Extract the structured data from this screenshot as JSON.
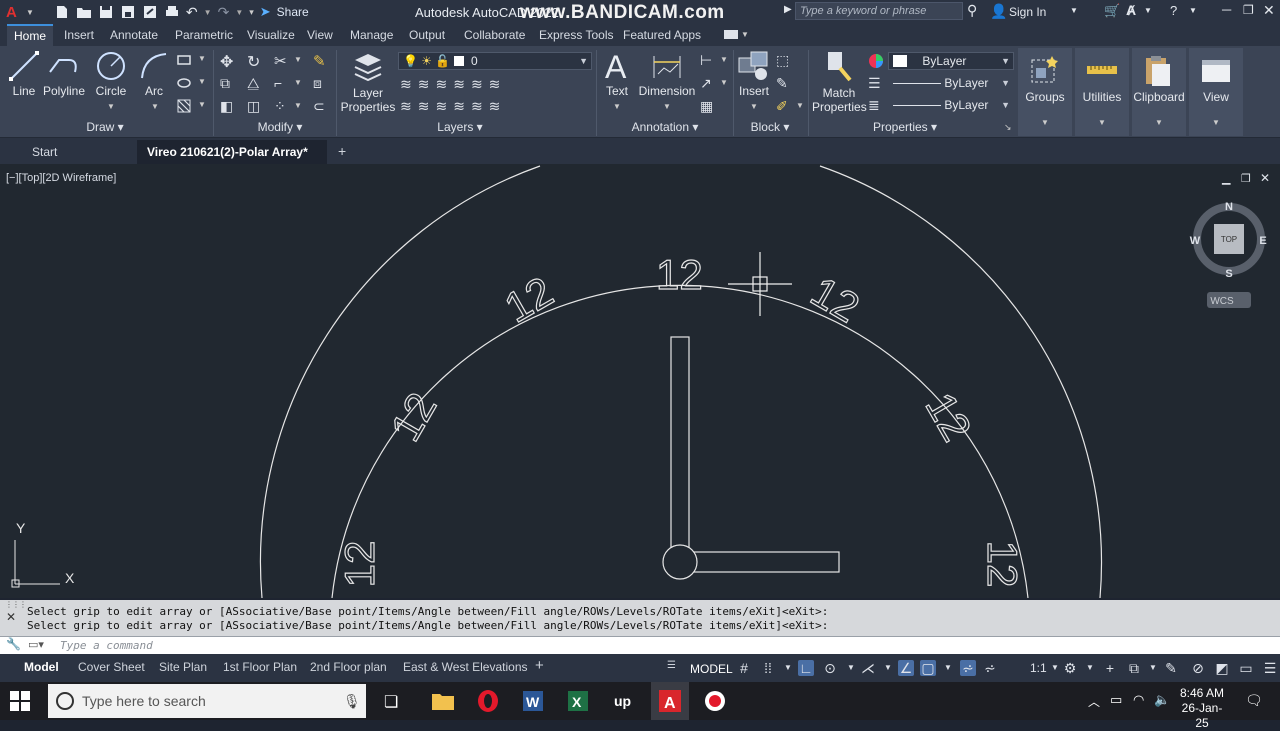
{
  "window": {
    "app_title": "Autodesk AutoCAD 2022",
    "doc_title_partial": "Vireo 210621(2)",
    "watermark": "www.BANDICAM.com",
    "share_label": "Share",
    "search_placeholder": "Type a keyword or phrase",
    "signin_label": "Sign In"
  },
  "ribbon_tabs": [
    "Home",
    "Insert",
    "Annotate",
    "Parametric",
    "Visualize",
    "View",
    "Manage",
    "Output",
    "Collaborate",
    "Express Tools",
    "Featured Apps"
  ],
  "active_tab": "Home",
  "draw": {
    "label": "Draw",
    "line": "Line",
    "polyline": "Polyline",
    "circle": "Circle",
    "arc": "Arc"
  },
  "modify": {
    "label": "Modify"
  },
  "layers": {
    "label": "Layers",
    "layer_properties_line1": "Layer",
    "layer_properties_line2": "Properties",
    "current_layer": "0"
  },
  "annotation": {
    "label": "Annotation",
    "text": "Text",
    "dimension": "Dimension"
  },
  "block": {
    "label": "Block",
    "insert": "Insert"
  },
  "properties": {
    "label": "Properties",
    "match_line1": "Match",
    "match_line2": "Properties",
    "color": "ByLayer",
    "linetype": "ByLayer",
    "lineweight": "ByLayer"
  },
  "groups": {
    "label": "Groups"
  },
  "utilities": {
    "label": "Utilities"
  },
  "clipboard": {
    "label": "Clipboard"
  },
  "viewpanel": {
    "label": "View"
  },
  "doc_tabs": {
    "start": "Start",
    "active": "Vireo 210621(2)-Polar Array*"
  },
  "viewport": {
    "label": "[−][Top][2D Wireframe]",
    "array_text": "12",
    "viewcube": {
      "top": "TOP",
      "n": "N",
      "s": "S",
      "e": "E",
      "w": "W",
      "wcs": "WCS"
    },
    "ucs": {
      "x": "X",
      "y": "Y"
    }
  },
  "command": {
    "history": [
      "Select grip to edit array or [ASsociative/Base point/Items/Angle between/Fill angle/ROWs/Levels/ROTate items/eXit]<eXit>:",
      "Select grip to edit array or [ASsociative/Base point/Items/Angle between/Fill angle/ROWs/Levels/ROTate items/eXit]<eXit>:"
    ],
    "placeholder": "Type a command"
  },
  "layout_tabs": [
    "Model",
    "Cover Sheet",
    "Site Plan",
    "1st Floor Plan",
    "2nd Floor plan",
    "East & West Elevations"
  ],
  "status": {
    "model": "MODEL",
    "scale": "1:1"
  },
  "taskbar": {
    "search_placeholder": "Type here to search",
    "time": "8:46 AM",
    "date": "26-Jan-25"
  },
  "colors": {
    "accent": "#3d8fdc",
    "ribbon_bg": "#3b4455",
    "canvas_bg": "#212830"
  }
}
